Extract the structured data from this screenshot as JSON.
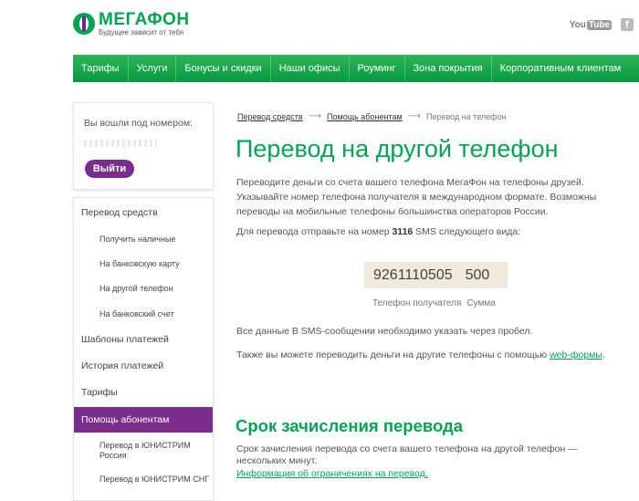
{
  "header": {
    "logo_name": "МЕГАФОН",
    "logo_tagline": "Будущее зависит от тебя",
    "youtube_you": "You",
    "youtube_tube": "Tube",
    "facebook_letter": "f"
  },
  "nav": {
    "items": [
      {
        "label": "Тарифы"
      },
      {
        "label": "Услуги"
      },
      {
        "label": "Бонусы и скидки"
      },
      {
        "label": "Наши офисы"
      },
      {
        "label": "Роуминг"
      },
      {
        "label": "Зона покрытия"
      },
      {
        "label": "Корпоративным клиентам"
      }
    ]
  },
  "sidebar": {
    "login_label": "Вы вошли под номером:",
    "logout_label": "Выйти",
    "menu": [
      {
        "label": "Перевод средств"
      },
      {
        "label": "Получить наличные"
      },
      {
        "label": "На банковскую карту"
      },
      {
        "label": "На другой телефон"
      },
      {
        "label": "На банковский счет"
      },
      {
        "label": "Шаблоны платежей"
      },
      {
        "label": "История платежей"
      },
      {
        "label": "Тарифы"
      },
      {
        "label": "Помощь абонентам"
      },
      {
        "label": "Перевод в ЮНИСТРИМ Россия"
      },
      {
        "label": "Перевод в ЮНИСТРИМ СНГ"
      }
    ]
  },
  "breadcrumb": {
    "item1": "Перевод средств",
    "item2": "Помощь абонентам",
    "current": "Перевод на телефон"
  },
  "content": {
    "title": "Перевод на другой телефон",
    "intro": "Переводите деньги со счета вашего телефона МегаФон на телефоны друзей. Указывайте номер телефона получателя в международном формате. Возможны переводы на мобильные телефоны большинства операторов России.",
    "sms_line_prefix": "Для перевода отправьте на номер ",
    "sms_number": "3116",
    "sms_line_suffix": " SMS следующего вида:",
    "sms_phone": "9261110505",
    "sms_amount": "500",
    "caption_phone": "Телефон получателя",
    "caption_amount": "Сумма",
    "note_spaces": "Все данные В SMS-сообщении необходимо указать через пробел.",
    "note_web_prefix": "Также вы можете переводить деньги на другие телефоны с помощью ",
    "note_web_link": "web-формы",
    "note_web_suffix": ".",
    "section_title": "Срок зачисления перевода",
    "section_text": "Срок зачисления перевода со счета вашего телефона на другой телефон — нескольких минут.",
    "section_link": "Информация об ограничениях на перевод",
    "section_link_suffix": "."
  }
}
